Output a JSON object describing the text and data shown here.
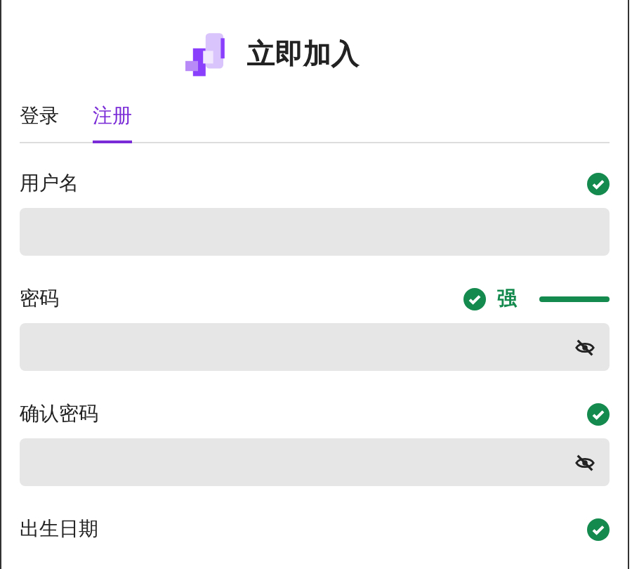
{
  "header": {
    "title": "立即加入"
  },
  "tabs": [
    {
      "label": "登录",
      "selected": false
    },
    {
      "label": "注册",
      "selected": true
    }
  ],
  "fields": [
    {
      "label": "用户名",
      "kind": "text",
      "valid": true
    },
    {
      "label": "密码",
      "kind": "password",
      "valid": true,
      "strength": {
        "label": "强",
        "level": 1
      }
    },
    {
      "label": "确认密码",
      "kind": "password",
      "valid": true
    },
    {
      "label": "出生日期",
      "kind": "date",
      "valid": true
    }
  ]
}
